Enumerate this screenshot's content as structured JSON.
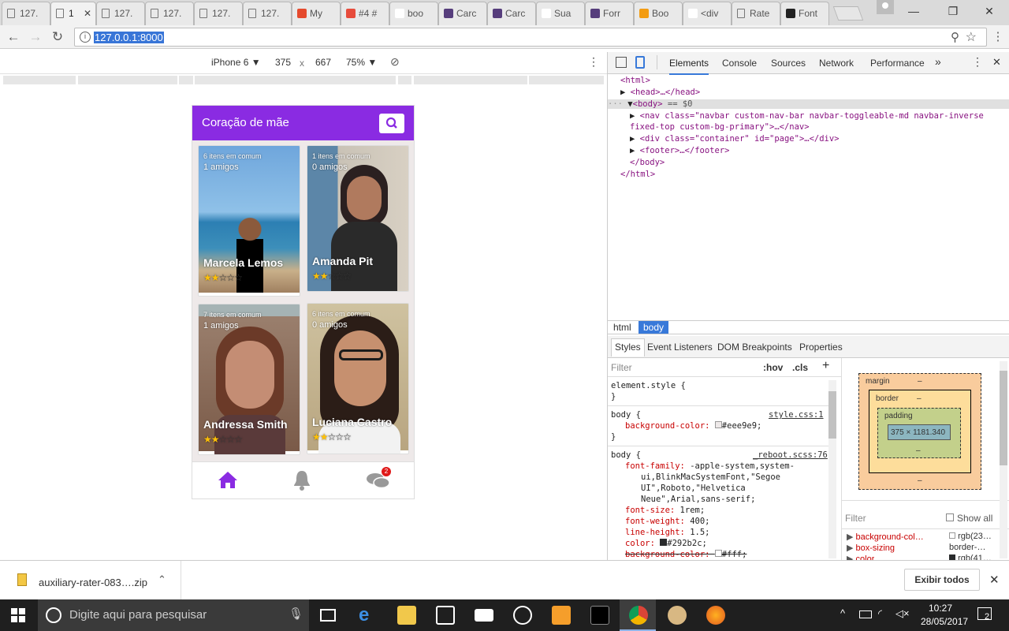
{
  "tabs": [
    {
      "label": "127.",
      "icon": "page-icon",
      "active": false
    },
    {
      "label": "1",
      "icon": "page-icon",
      "active": true
    },
    {
      "label": "127.",
      "icon": "page-icon",
      "active": false
    },
    {
      "label": "127.",
      "icon": "page-icon",
      "active": false
    },
    {
      "label": "127.",
      "icon": "page-icon",
      "active": false
    },
    {
      "label": "127.",
      "icon": "page-icon",
      "active": false
    },
    {
      "label": "My",
      "icon": "grid-icon",
      "active": false
    },
    {
      "label": "#4 #",
      "icon": "bookmark-icon",
      "active": false
    },
    {
      "label": "boo",
      "icon": "google-icon",
      "active": false
    },
    {
      "label": "Carc",
      "icon": "bootstrap-icon",
      "active": false
    },
    {
      "label": "Carc",
      "icon": "bootstrap-icon",
      "active": false
    },
    {
      "label": "Sua",
      "icon": "gmail-icon",
      "active": false
    },
    {
      "label": "Forr",
      "icon": "bootstrap-icon",
      "active": false
    },
    {
      "label": "Boo",
      "icon": "search-q-icon",
      "active": false
    },
    {
      "label": "<div",
      "icon": "google-icon",
      "active": false
    },
    {
      "label": "Rate",
      "icon": "page-icon",
      "active": false
    },
    {
      "label": "Font",
      "icon": "flag-icon",
      "active": false
    }
  ],
  "omnibox": {
    "url": "127.0.0.1:8000"
  },
  "device_toolbar": {
    "device": "iPhone 6",
    "width": "375",
    "x": "x",
    "height": "667",
    "zoom": "75%"
  },
  "app": {
    "brand": "Coração de mãe",
    "accent": "#8a2be2",
    "cards": [
      {
        "common": "6 itens em comum",
        "friends": "1 amigos",
        "name": "Marcela Lemos",
        "rating": 2,
        "max": 5
      },
      {
        "common": "1 itens em comum",
        "friends": "0 amigos",
        "name": "Amanda Pit",
        "rating": 2,
        "max": 5
      },
      {
        "common": "7 itens em comum",
        "friends": "1 amigos",
        "name": "Andressa Smith",
        "rating": 2,
        "max": 5
      },
      {
        "common": "6 itens em comum",
        "friends": "0 amigos",
        "name": "Luciana Castro",
        "rating": 2,
        "max": 5
      }
    ],
    "chat_badge": "2"
  },
  "devtools": {
    "tabs": [
      "Elements",
      "Console",
      "Sources",
      "Network",
      "Performance"
    ],
    "tree": {
      "l1": "<html>",
      "l2": "<head>…</head>",
      "l3a": "<body>",
      "l3b": "== $0",
      "l4": "<nav class=\"navbar custom-nav-bar navbar-toggleable-md navbar-inverse",
      "l4b": "fixed-top custom-bg-primary\">…</nav>",
      "l5": "<div class=\"container\" id=\"page\">…</div>",
      "l6": "<footer>…</footer>",
      "l7": "</body>",
      "l8": "</html>"
    },
    "crumbs": [
      "html",
      "body"
    ],
    "subtabs": [
      "Styles",
      "Event Listeners",
      "DOM Breakpoints",
      "Properties"
    ],
    "filter": "Filter",
    "hov": ":hov",
    "cls": ".cls",
    "styles": {
      "r1": "element.style {",
      "r1e": "}",
      "r2": "body {",
      "r2src": "style.css:1",
      "r2p": "background-color:",
      "r2v": "#eee9e9;",
      "r2e": "}",
      "r3": "body {",
      "r3src": "_reboot.scss:76",
      "r3p1": "font-family:",
      "r3v1": "-apple-system,system-",
      "r3v1b": "ui,BlinkMacSystemFont,\"Segoe",
      "r3v1c": "UI\",Roboto,\"Helvetica",
      "r3v1d": "Neue\",Arial,sans-serif;",
      "r3p2": "font-size:",
      "r3v2": "1rem;",
      "r3p3": "font-weight:",
      "r3v3": "400;",
      "r3p4": "line-height:",
      "r3v4": "1.5;",
      "r3p5": "color:",
      "r3v5": "#292b2c;",
      "r3p6": "background-color:",
      "r3v6": "#fff;"
    },
    "boxmodel": {
      "margin": "margin",
      "dash": "–",
      "border": "border",
      "padding": "padding",
      "content": "375 × 1181.340"
    },
    "computed": {
      "filter": "Filter",
      "showall": "Show all",
      "p1": "background-col…",
      "v1": "rgb(23…",
      "p2": "box-sizing",
      "v2": "border-…",
      "p3": "color",
      "v3": "rgb(41…"
    }
  },
  "download": {
    "file": "auxiliary-rater-083….zip",
    "show_all": "Exibir todos"
  },
  "taskbar": {
    "search": "Digite aqui para pesquisar",
    "time": "10:27",
    "date": "28/05/2017",
    "notif": "2"
  }
}
